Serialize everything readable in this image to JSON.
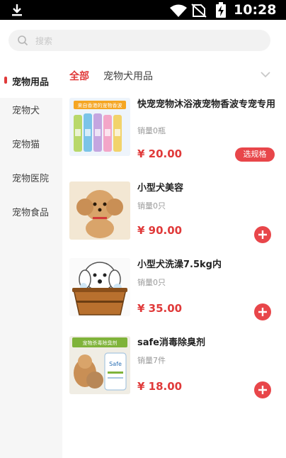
{
  "status_bar": {
    "time": "10:28"
  },
  "search": {
    "placeholder": "搜索"
  },
  "sidebar": {
    "items": [
      {
        "label": "宠物用品"
      },
      {
        "label": "宠物犬"
      },
      {
        "label": "宠物猫"
      },
      {
        "label": "宠物医院"
      },
      {
        "label": "宠物食品"
      }
    ],
    "active_index": 0
  },
  "tabs": [
    {
      "label": "全部"
    },
    {
      "label": "宠物犬用品"
    }
  ],
  "products": [
    {
      "name": "快宠宠物沐浴液宠物香波专宠专用",
      "sales": "销量0瓶",
      "price": "¥ 20.00",
      "action": "选规格",
      "thumb_banner": "来自香港的宠物香波"
    },
    {
      "name": "小型犬美容",
      "sales": "销量0只",
      "price": "¥ 90.00"
    },
    {
      "name": "小型犬洗澡7.5kg内",
      "sales": "销量0只",
      "price": "¥ 35.00"
    },
    {
      "name": "safe消毒除臭剂",
      "sales": "销量7件",
      "price": "¥ 18.00",
      "thumb_banner": "宠物杀毒除臭剂",
      "thumb_brand": "Safe"
    }
  ],
  "colors": {
    "accent": "#e03a3a",
    "sidebar_bg": "#f6f6f6",
    "search_bg": "#f2f2f2"
  },
  "icons": [
    "download-icon",
    "wifi-icon",
    "no-sim-icon",
    "battery-charging-icon",
    "search-icon",
    "chevron-down-icon",
    "add-icon"
  ]
}
